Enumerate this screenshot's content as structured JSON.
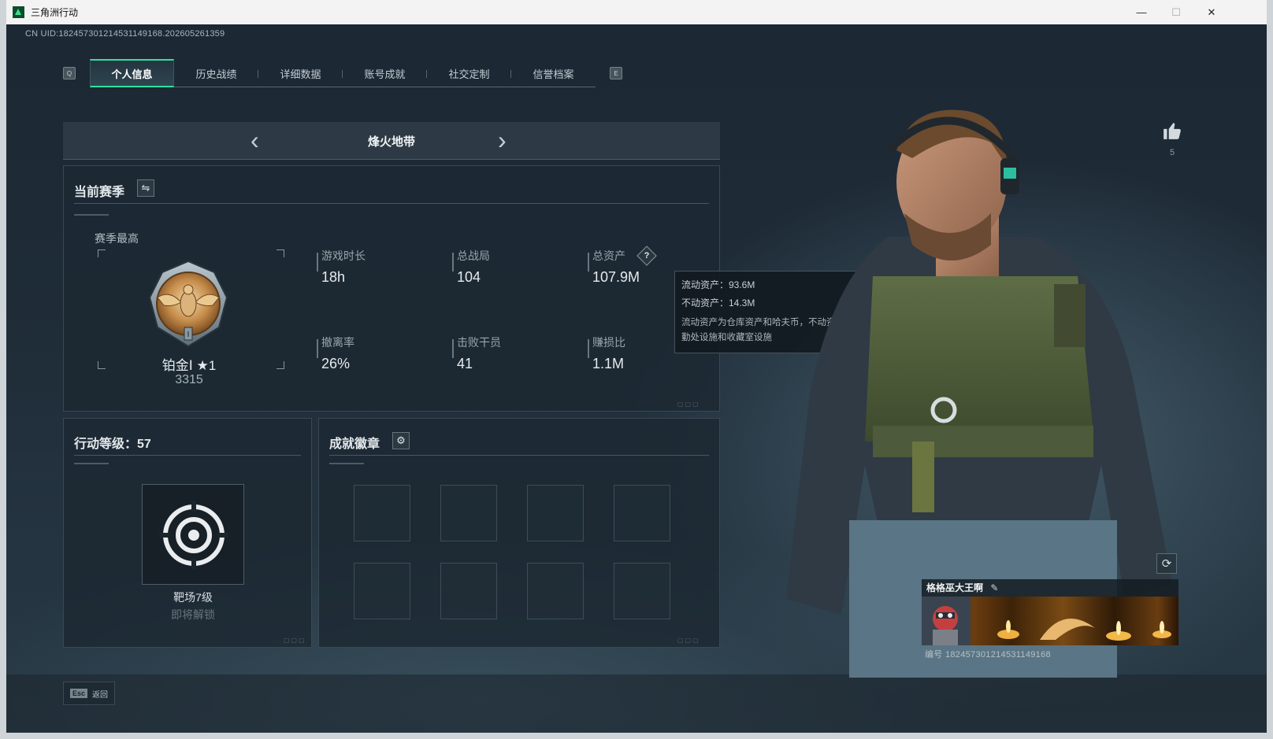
{
  "window": {
    "title": "三角洲行动",
    "minimize": "—",
    "maximize": "☐",
    "close": "✕"
  },
  "uid_text": "CN UID:1824573012145311491​68.202605261359",
  "tabs": {
    "left_key": "Q",
    "right_key": "E",
    "items": [
      {
        "label": "个人信息",
        "active": true
      },
      {
        "label": "历史战绩"
      },
      {
        "label": "详细数据"
      },
      {
        "label": "账号成就"
      },
      {
        "label": "社交定制"
      },
      {
        "label": "信誉档案"
      }
    ]
  },
  "mode": {
    "title": "烽火地带",
    "prev": "‹",
    "next": "›"
  },
  "season": {
    "heading": "当前赛季",
    "swap_icon": "⇋",
    "best_label": "赛季最高",
    "rank_name": "铂金Ⅰ ★1",
    "rank_score": "3315",
    "stats": [
      {
        "label": "游戏时长",
        "value": "18h"
      },
      {
        "label": "总战局",
        "value": "104"
      },
      {
        "label": "总资产",
        "value": "107.9M"
      },
      {
        "label": "撤离率",
        "value": "26%"
      },
      {
        "label": "击败干员",
        "value": "41"
      },
      {
        "label": "赚损比",
        "value": "1.1M"
      }
    ],
    "help_icon": "?"
  },
  "tooltip": {
    "line1": "流动资产：93.6M",
    "line2": "不动资产：14.3M",
    "desc": "流动资产为仓库资产和哈夫币，不动资产为特勤处设施和收藏室设施"
  },
  "level": {
    "heading": "行动等级：57",
    "item_name": "靶场7级",
    "item_status": "即将解锁"
  },
  "badges": {
    "heading": "成就徽章",
    "gear_icon": "⚙"
  },
  "like": {
    "icon": "thumbs-up-icon",
    "count": "5"
  },
  "card": {
    "name": "格格巫大王啊",
    "edit_icon": "✎",
    "id_text": "编号 1824573012145311491​68"
  },
  "footer": {
    "esc_key": "Esc",
    "back_label": "返回"
  },
  "colors": {
    "accent": "#2fe19c",
    "bg": "#1c2834"
  }
}
